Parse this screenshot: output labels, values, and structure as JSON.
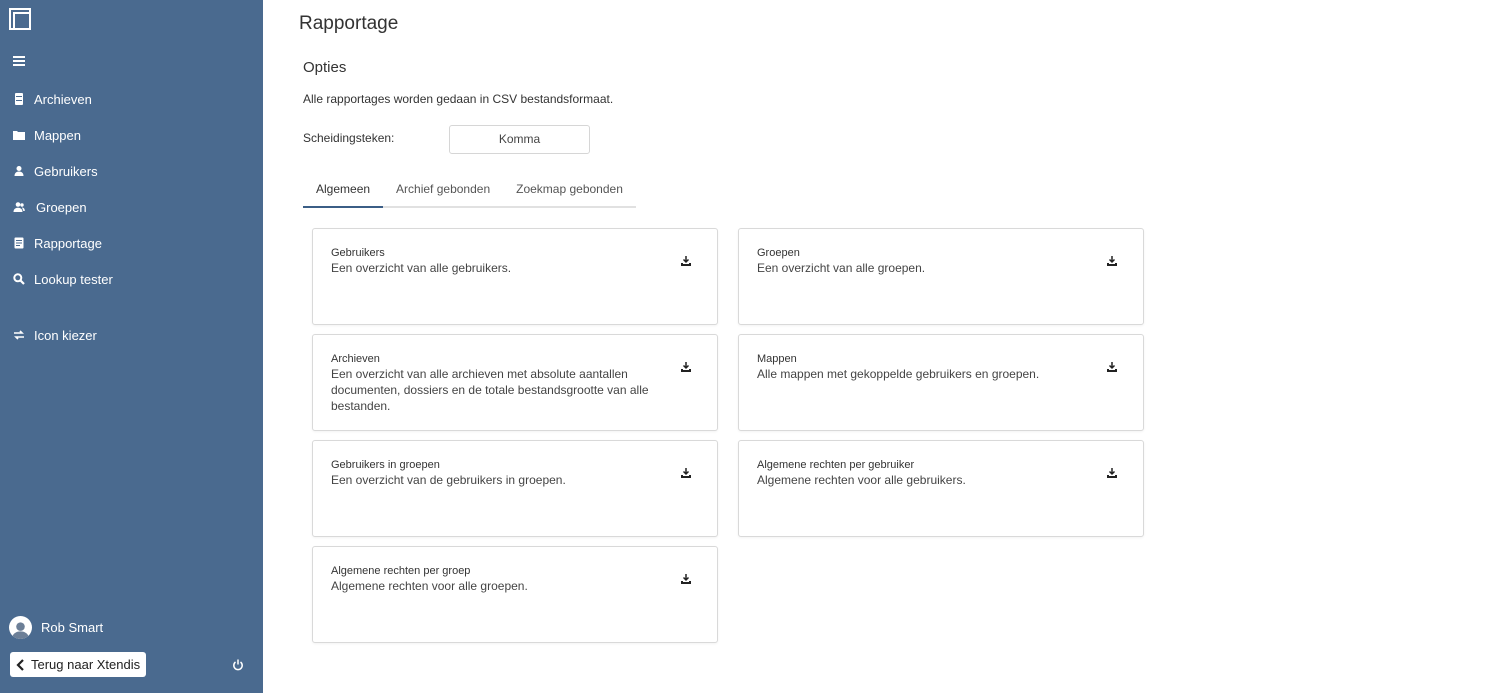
{
  "sidebar": {
    "items": [
      {
        "label": "Archieven",
        "icon": "archive-icon"
      },
      {
        "label": "Mappen",
        "icon": "folder-icon"
      },
      {
        "label": "Gebruikers",
        "icon": "user-icon"
      },
      {
        "label": "Groepen",
        "icon": "users-icon"
      },
      {
        "label": "Rapportage",
        "icon": "report-icon"
      },
      {
        "label": "Lookup tester",
        "icon": "search-icon"
      },
      {
        "label": "Icon kiezer",
        "icon": "swap-icon"
      }
    ],
    "user_name": "Rob Smart",
    "back_label": "Terug naar Xtendis"
  },
  "main": {
    "title": "Rapportage",
    "section_title": "Opties",
    "description": "Alle rapportages worden gedaan in CSV bestandsformaat.",
    "separator_label": "Scheidingsteken:",
    "separator_value": "Komma",
    "tabs": [
      {
        "label": "Algemeen",
        "active": true
      },
      {
        "label": "Archief gebonden",
        "active": false
      },
      {
        "label": "Zoekmap gebonden",
        "active": false
      }
    ],
    "cards": [
      {
        "title": "Gebruikers",
        "desc": "Een overzicht van alle gebruikers."
      },
      {
        "title": "Groepen",
        "desc": "Een overzicht van alle groepen."
      },
      {
        "title": "Archieven",
        "desc": "Een overzicht van alle archieven met absolute aantallen documenten, dossiers en de totale bestandsgrootte van alle bestanden."
      },
      {
        "title": "Mappen",
        "desc": "Alle mappen met gekoppelde gebruikers en groepen."
      },
      {
        "title": "Gebruikers in groepen",
        "desc": "Een overzicht van de gebruikers in groepen."
      },
      {
        "title": "Algemene rechten per gebruiker",
        "desc": "Algemene rechten voor alle gebruikers."
      },
      {
        "title": "Algemene rechten per groep",
        "desc": "Algemene rechten voor alle groepen."
      }
    ]
  },
  "colors": {
    "sidebar": "#4a6a8f",
    "accent": "#3b5e86"
  }
}
